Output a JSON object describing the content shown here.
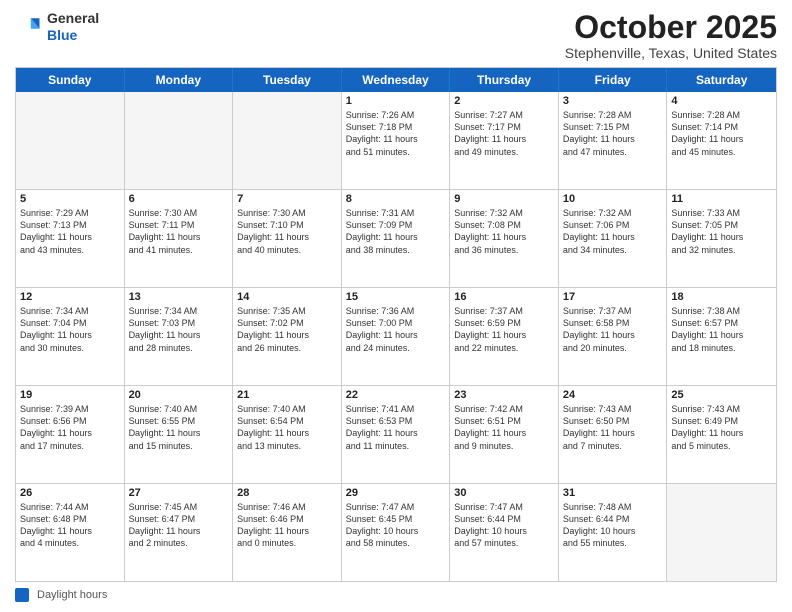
{
  "header": {
    "logo_general": "General",
    "logo_blue": "Blue",
    "month_title": "October 2025",
    "subtitle": "Stephenville, Texas, United States"
  },
  "weekdays": [
    "Sunday",
    "Monday",
    "Tuesday",
    "Wednesday",
    "Thursday",
    "Friday",
    "Saturday"
  ],
  "footer": {
    "legend_label": "Daylight hours"
  },
  "weeks": [
    [
      {
        "day": "",
        "info": ""
      },
      {
        "day": "",
        "info": ""
      },
      {
        "day": "",
        "info": ""
      },
      {
        "day": "1",
        "info": "Sunrise: 7:26 AM\nSunset: 7:18 PM\nDaylight: 11 hours\nand 51 minutes."
      },
      {
        "day": "2",
        "info": "Sunrise: 7:27 AM\nSunset: 7:17 PM\nDaylight: 11 hours\nand 49 minutes."
      },
      {
        "day": "3",
        "info": "Sunrise: 7:28 AM\nSunset: 7:15 PM\nDaylight: 11 hours\nand 47 minutes."
      },
      {
        "day": "4",
        "info": "Sunrise: 7:28 AM\nSunset: 7:14 PM\nDaylight: 11 hours\nand 45 minutes."
      }
    ],
    [
      {
        "day": "5",
        "info": "Sunrise: 7:29 AM\nSunset: 7:13 PM\nDaylight: 11 hours\nand 43 minutes."
      },
      {
        "day": "6",
        "info": "Sunrise: 7:30 AM\nSunset: 7:11 PM\nDaylight: 11 hours\nand 41 minutes."
      },
      {
        "day": "7",
        "info": "Sunrise: 7:30 AM\nSunset: 7:10 PM\nDaylight: 11 hours\nand 40 minutes."
      },
      {
        "day": "8",
        "info": "Sunrise: 7:31 AM\nSunset: 7:09 PM\nDaylight: 11 hours\nand 38 minutes."
      },
      {
        "day": "9",
        "info": "Sunrise: 7:32 AM\nSunset: 7:08 PM\nDaylight: 11 hours\nand 36 minutes."
      },
      {
        "day": "10",
        "info": "Sunrise: 7:32 AM\nSunset: 7:06 PM\nDaylight: 11 hours\nand 34 minutes."
      },
      {
        "day": "11",
        "info": "Sunrise: 7:33 AM\nSunset: 7:05 PM\nDaylight: 11 hours\nand 32 minutes."
      }
    ],
    [
      {
        "day": "12",
        "info": "Sunrise: 7:34 AM\nSunset: 7:04 PM\nDaylight: 11 hours\nand 30 minutes."
      },
      {
        "day": "13",
        "info": "Sunrise: 7:34 AM\nSunset: 7:03 PM\nDaylight: 11 hours\nand 28 minutes."
      },
      {
        "day": "14",
        "info": "Sunrise: 7:35 AM\nSunset: 7:02 PM\nDaylight: 11 hours\nand 26 minutes."
      },
      {
        "day": "15",
        "info": "Sunrise: 7:36 AM\nSunset: 7:00 PM\nDaylight: 11 hours\nand 24 minutes."
      },
      {
        "day": "16",
        "info": "Sunrise: 7:37 AM\nSunset: 6:59 PM\nDaylight: 11 hours\nand 22 minutes."
      },
      {
        "day": "17",
        "info": "Sunrise: 7:37 AM\nSunset: 6:58 PM\nDaylight: 11 hours\nand 20 minutes."
      },
      {
        "day": "18",
        "info": "Sunrise: 7:38 AM\nSunset: 6:57 PM\nDaylight: 11 hours\nand 18 minutes."
      }
    ],
    [
      {
        "day": "19",
        "info": "Sunrise: 7:39 AM\nSunset: 6:56 PM\nDaylight: 11 hours\nand 17 minutes."
      },
      {
        "day": "20",
        "info": "Sunrise: 7:40 AM\nSunset: 6:55 PM\nDaylight: 11 hours\nand 15 minutes."
      },
      {
        "day": "21",
        "info": "Sunrise: 7:40 AM\nSunset: 6:54 PM\nDaylight: 11 hours\nand 13 minutes."
      },
      {
        "day": "22",
        "info": "Sunrise: 7:41 AM\nSunset: 6:53 PM\nDaylight: 11 hours\nand 11 minutes."
      },
      {
        "day": "23",
        "info": "Sunrise: 7:42 AM\nSunset: 6:51 PM\nDaylight: 11 hours\nand 9 minutes."
      },
      {
        "day": "24",
        "info": "Sunrise: 7:43 AM\nSunset: 6:50 PM\nDaylight: 11 hours\nand 7 minutes."
      },
      {
        "day": "25",
        "info": "Sunrise: 7:43 AM\nSunset: 6:49 PM\nDaylight: 11 hours\nand 5 minutes."
      }
    ],
    [
      {
        "day": "26",
        "info": "Sunrise: 7:44 AM\nSunset: 6:48 PM\nDaylight: 11 hours\nand 4 minutes."
      },
      {
        "day": "27",
        "info": "Sunrise: 7:45 AM\nSunset: 6:47 PM\nDaylight: 11 hours\nand 2 minutes."
      },
      {
        "day": "28",
        "info": "Sunrise: 7:46 AM\nSunset: 6:46 PM\nDaylight: 11 hours\nand 0 minutes."
      },
      {
        "day": "29",
        "info": "Sunrise: 7:47 AM\nSunset: 6:45 PM\nDaylight: 10 hours\nand 58 minutes."
      },
      {
        "day": "30",
        "info": "Sunrise: 7:47 AM\nSunset: 6:44 PM\nDaylight: 10 hours\nand 57 minutes."
      },
      {
        "day": "31",
        "info": "Sunrise: 7:48 AM\nSunset: 6:44 PM\nDaylight: 10 hours\nand 55 minutes."
      },
      {
        "day": "",
        "info": ""
      }
    ]
  ]
}
